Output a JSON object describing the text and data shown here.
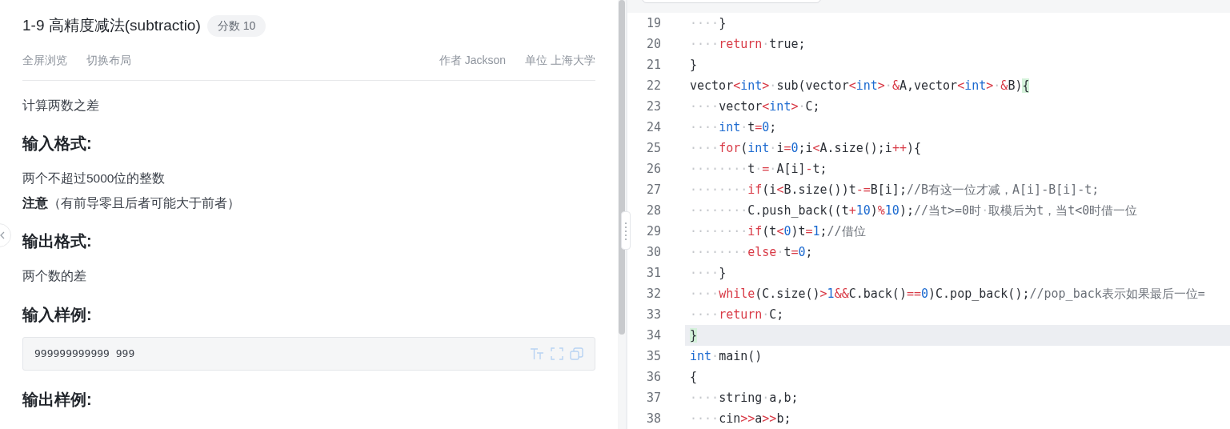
{
  "problem": {
    "title": "1-9 高精度减法(subtractio)",
    "score_badge": "分数 10",
    "actions": [
      "全屏浏览",
      "切换布局"
    ],
    "meta": [
      {
        "label": "作者",
        "value": "Jackson"
      },
      {
        "label": "单位",
        "value": "上海大学"
      }
    ],
    "sections": [
      {
        "kind": "paragraph",
        "text": "计算两数之差"
      },
      {
        "kind": "heading",
        "text": "输入格式:"
      },
      {
        "kind": "paragraph",
        "text": "两个不超过5000位的整数"
      },
      {
        "kind": "paragraph",
        "text": "**注意**（有前导零且后者可能大于前者）"
      },
      {
        "kind": "heading",
        "text": "输出格式:"
      },
      {
        "kind": "paragraph",
        "text": "两个数的差"
      },
      {
        "kind": "heading",
        "text": "输入样例:"
      },
      {
        "kind": "sample",
        "text": "999999999999 999"
      },
      {
        "kind": "heading",
        "text": "输出样例:"
      }
    ]
  },
  "editor": {
    "lines": [
      {
        "number": "19",
        "active": false,
        "tokens": [
          {
            "kind": "ws",
            "text": "····"
          },
          {
            "kind": "plain",
            "text": "}"
          }
        ]
      },
      {
        "number": "20",
        "active": false,
        "tokens": [
          {
            "kind": "ws",
            "text": "····"
          },
          {
            "kind": "kw",
            "text": "return"
          },
          {
            "kind": "ws",
            "text": "·"
          },
          {
            "kind": "plain",
            "text": "true;"
          }
        ]
      },
      {
        "number": "21",
        "active": false,
        "tokens": [
          {
            "kind": "plain",
            "text": "}"
          }
        ]
      },
      {
        "number": "22",
        "active": false,
        "tokens": [
          {
            "kind": "plain",
            "text": "vector"
          },
          {
            "kind": "op",
            "text": "<"
          },
          {
            "kind": "type",
            "text": "int"
          },
          {
            "kind": "op",
            "text": ">"
          },
          {
            "kind": "ws",
            "text": "·"
          },
          {
            "kind": "plain",
            "text": "sub(vector"
          },
          {
            "kind": "op",
            "text": "<"
          },
          {
            "kind": "type",
            "text": "int"
          },
          {
            "kind": "op",
            "text": ">"
          },
          {
            "kind": "ws",
            "text": "·"
          },
          {
            "kind": "op",
            "text": "&"
          },
          {
            "kind": "plain",
            "text": "A,vector"
          },
          {
            "kind": "op",
            "text": "<"
          },
          {
            "kind": "type",
            "text": "int"
          },
          {
            "kind": "op",
            "text": ">"
          },
          {
            "kind": "ws",
            "text": "·"
          },
          {
            "kind": "op",
            "text": "&"
          },
          {
            "kind": "plain",
            "text": "B)"
          },
          {
            "kind": "match",
            "text": "{"
          }
        ]
      },
      {
        "number": "23",
        "active": false,
        "tokens": [
          {
            "kind": "ws",
            "text": "····"
          },
          {
            "kind": "plain",
            "text": "vector"
          },
          {
            "kind": "op",
            "text": "<"
          },
          {
            "kind": "type",
            "text": "int"
          },
          {
            "kind": "op",
            "text": ">"
          },
          {
            "kind": "ws",
            "text": "·"
          },
          {
            "kind": "plain",
            "text": "C;"
          }
        ]
      },
      {
        "number": "24",
        "active": false,
        "tokens": [
          {
            "kind": "ws",
            "text": "····"
          },
          {
            "kind": "type",
            "text": "int"
          },
          {
            "kind": "ws",
            "text": "·"
          },
          {
            "kind": "plain",
            "text": "t"
          },
          {
            "kind": "op",
            "text": "="
          },
          {
            "kind": "num",
            "text": "0"
          },
          {
            "kind": "plain",
            "text": ";"
          }
        ]
      },
      {
        "number": "25",
        "active": false,
        "tokens": [
          {
            "kind": "ws",
            "text": "····"
          },
          {
            "kind": "kw",
            "text": "for"
          },
          {
            "kind": "plain",
            "text": "("
          },
          {
            "kind": "type",
            "text": "int"
          },
          {
            "kind": "ws",
            "text": "·"
          },
          {
            "kind": "plain",
            "text": "i"
          },
          {
            "kind": "op",
            "text": "="
          },
          {
            "kind": "num",
            "text": "0"
          },
          {
            "kind": "plain",
            "text": ";i"
          },
          {
            "kind": "op",
            "text": "<"
          },
          {
            "kind": "plain",
            "text": "A.size();i"
          },
          {
            "kind": "op",
            "text": "++"
          },
          {
            "kind": "plain",
            "text": "){"
          }
        ]
      },
      {
        "number": "26",
        "active": false,
        "tokens": [
          {
            "kind": "ws",
            "text": "········"
          },
          {
            "kind": "plain",
            "text": "t"
          },
          {
            "kind": "ws",
            "text": "·"
          },
          {
            "kind": "op",
            "text": "="
          },
          {
            "kind": "ws",
            "text": "·"
          },
          {
            "kind": "plain",
            "text": "A[i]"
          },
          {
            "kind": "op",
            "text": "-"
          },
          {
            "kind": "plain",
            "text": "t;"
          }
        ]
      },
      {
        "number": "27",
        "active": false,
        "tokens": [
          {
            "kind": "ws",
            "text": "········"
          },
          {
            "kind": "kw",
            "text": "if"
          },
          {
            "kind": "plain",
            "text": "(i"
          },
          {
            "kind": "op",
            "text": "<"
          },
          {
            "kind": "plain",
            "text": "B.size())t"
          },
          {
            "kind": "op",
            "text": "-="
          },
          {
            "kind": "plain",
            "text": "B[i];"
          },
          {
            "kind": "comment",
            "text": "//B有这一位才减，A[i]-B[i]-t;"
          }
        ]
      },
      {
        "number": "28",
        "active": false,
        "tokens": [
          {
            "kind": "ws",
            "text": "········"
          },
          {
            "kind": "plain",
            "text": "C.push_back((t"
          },
          {
            "kind": "op",
            "text": "+"
          },
          {
            "kind": "num",
            "text": "10"
          },
          {
            "kind": "plain",
            "text": ")"
          },
          {
            "kind": "op",
            "text": "%"
          },
          {
            "kind": "num",
            "text": "10"
          },
          {
            "kind": "plain",
            "text": ");"
          },
          {
            "kind": "comment",
            "text": "//当t>=0时"
          },
          {
            "kind": "ws",
            "text": "·"
          },
          {
            "kind": "comment",
            "text": "取模后为t，当t<0时借一位"
          }
        ]
      },
      {
        "number": "29",
        "active": false,
        "tokens": [
          {
            "kind": "ws",
            "text": "········"
          },
          {
            "kind": "kw",
            "text": "if"
          },
          {
            "kind": "plain",
            "text": "(t"
          },
          {
            "kind": "op",
            "text": "<"
          },
          {
            "kind": "num",
            "text": "0"
          },
          {
            "kind": "plain",
            "text": ")t"
          },
          {
            "kind": "op",
            "text": "="
          },
          {
            "kind": "num",
            "text": "1"
          },
          {
            "kind": "plain",
            "text": ";"
          },
          {
            "kind": "comment",
            "text": "//借位"
          }
        ]
      },
      {
        "number": "30",
        "active": false,
        "tokens": [
          {
            "kind": "ws",
            "text": "········"
          },
          {
            "kind": "kw",
            "text": "else"
          },
          {
            "kind": "ws",
            "text": "·"
          },
          {
            "kind": "plain",
            "text": "t"
          },
          {
            "kind": "op",
            "text": "="
          },
          {
            "kind": "num",
            "text": "0"
          },
          {
            "kind": "plain",
            "text": ";"
          }
        ]
      },
      {
        "number": "31",
        "active": false,
        "tokens": [
          {
            "kind": "ws",
            "text": "····"
          },
          {
            "kind": "plain",
            "text": "}"
          }
        ]
      },
      {
        "number": "32",
        "active": false,
        "tokens": [
          {
            "kind": "ws",
            "text": "····"
          },
          {
            "kind": "kw",
            "text": "while"
          },
          {
            "kind": "plain",
            "text": "(C.size()"
          },
          {
            "kind": "op",
            "text": ">"
          },
          {
            "kind": "num",
            "text": "1"
          },
          {
            "kind": "op",
            "text": "&&"
          },
          {
            "kind": "plain",
            "text": "C.back()"
          },
          {
            "kind": "op",
            "text": "=="
          },
          {
            "kind": "num",
            "text": "0"
          },
          {
            "kind": "plain",
            "text": ")C.pop_back();"
          },
          {
            "kind": "comment",
            "text": "//pop_back表示如果最后一位="
          }
        ]
      },
      {
        "number": "33",
        "active": false,
        "tokens": [
          {
            "kind": "ws",
            "text": "····"
          },
          {
            "kind": "kw",
            "text": "return"
          },
          {
            "kind": "ws",
            "text": "·"
          },
          {
            "kind": "plain",
            "text": "C;"
          }
        ]
      },
      {
        "number": "34",
        "active": true,
        "tokens": [
          {
            "kind": "match",
            "text": "}"
          }
        ]
      },
      {
        "number": "35",
        "active": false,
        "tokens": [
          {
            "kind": "type",
            "text": "int"
          },
          {
            "kind": "ws",
            "text": "·"
          },
          {
            "kind": "plain",
            "text": "main()"
          }
        ]
      },
      {
        "number": "36",
        "active": false,
        "tokens": [
          {
            "kind": "plain",
            "text": "{"
          }
        ]
      },
      {
        "number": "37",
        "active": false,
        "tokens": [
          {
            "kind": "ws",
            "text": "····"
          },
          {
            "kind": "plain",
            "text": "string"
          },
          {
            "kind": "ws",
            "text": "·"
          },
          {
            "kind": "plain",
            "text": "a,b;"
          }
        ]
      },
      {
        "number": "38",
        "active": false,
        "tokens": [
          {
            "kind": "ws",
            "text": "····"
          },
          {
            "kind": "plain",
            "text": "cin"
          },
          {
            "kind": "op",
            "text": ">>"
          },
          {
            "kind": "plain",
            "text": "a"
          },
          {
            "kind": "op",
            "text": ">>"
          },
          {
            "kind": "plain",
            "text": "b;"
          }
        ]
      }
    ]
  }
}
